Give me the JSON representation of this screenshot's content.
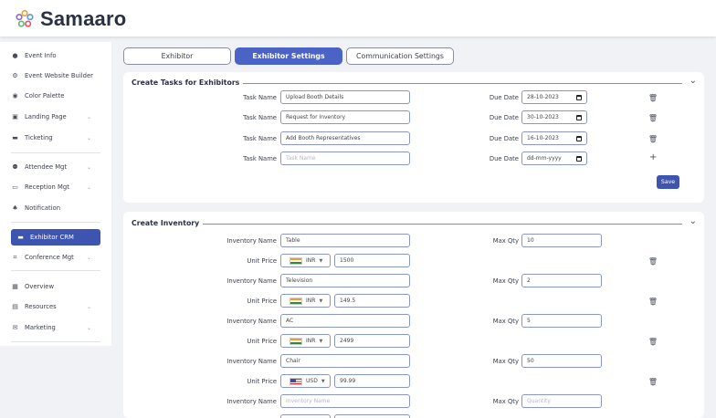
{
  "brand": {
    "name": "Samaaro"
  },
  "sidebar": {
    "items": [
      {
        "label": "Event Info",
        "icon": "info-icon"
      },
      {
        "label": "Event Website Builder",
        "icon": "builder-icon"
      },
      {
        "label": "Color Palette",
        "icon": "palette-icon"
      },
      {
        "label": "Landing Page",
        "icon": "image-icon"
      },
      {
        "label": "Ticketing",
        "icon": "ticket-icon"
      },
      {
        "label": "Attendee Mgt",
        "icon": "users-icon"
      },
      {
        "label": "Reception Mgt",
        "icon": "reception-icon"
      },
      {
        "label": "Notification",
        "icon": "bell-icon"
      },
      {
        "label": "Exhibitor CRM",
        "icon": "crm-icon"
      },
      {
        "label": "Conference Mgt",
        "icon": "conference-icon"
      },
      {
        "label": "Overview",
        "icon": "grid-icon"
      },
      {
        "label": "Resources",
        "icon": "file-icon"
      },
      {
        "label": "Marketing",
        "icon": "mail-icon"
      }
    ]
  },
  "tabs": [
    {
      "label": "Exhibitor"
    },
    {
      "label": "Exhibitor Settings"
    },
    {
      "label": "Communication Settings"
    }
  ],
  "tasks": {
    "title": "Create Tasks for Exhibitors",
    "name_label": "Task Name",
    "date_label": "Due Date",
    "rows": [
      {
        "name": "Upload Booth Details",
        "date": "28-10-2023"
      },
      {
        "name": "Request for Inventory",
        "date": "30-10-2023"
      },
      {
        "name": "Add Booth Representatives",
        "date": "16-10-2023"
      }
    ],
    "new_row": {
      "name_placeholder": "Task Name",
      "date_placeholder": "dd-mm-yyyy"
    },
    "save_label": "Save"
  },
  "inventory": {
    "title": "Create Inventory",
    "name_label": "Inventory Name",
    "price_label": "Unit Price",
    "qty_label": "Max Qty",
    "rows": [
      {
        "name": "Table",
        "qty": "10",
        "currency": "INR",
        "price": "1500"
      },
      {
        "name": "Television",
        "qty": "2",
        "currency": "INR",
        "price": "149.5"
      },
      {
        "name": "AC",
        "qty": "5",
        "currency": "INR",
        "price": "2499"
      },
      {
        "name": "Chair",
        "qty": "50",
        "currency": "USD",
        "price": "99.99"
      }
    ],
    "new_row": {
      "name_placeholder": "Inventory Name",
      "qty_placeholder": "Quantity"
    }
  }
}
